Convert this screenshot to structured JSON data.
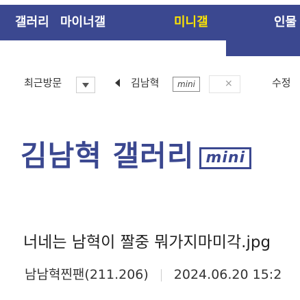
{
  "nav": {
    "gallery": "갤러리",
    "mygallery": "마이너갤",
    "minigallery": "미니갤",
    "popular": "인물"
  },
  "toolbar": {
    "recent_label": "최근방문",
    "current_gallery": "김남혁",
    "mini_badge": "mini",
    "close_symbol": "×",
    "more_label": "수정"
  },
  "gallery": {
    "title": "김남혁 갤러리",
    "mini_tag": "mini"
  },
  "post": {
    "title": "너네는 남혁이 짤중 뭐가지마미각.jpg",
    "author": "남남혁찐팬(211.206)",
    "date": "2024.06.20 15:2"
  },
  "colors": {
    "brand": "#3b4890",
    "highlight": "#ffe500"
  }
}
